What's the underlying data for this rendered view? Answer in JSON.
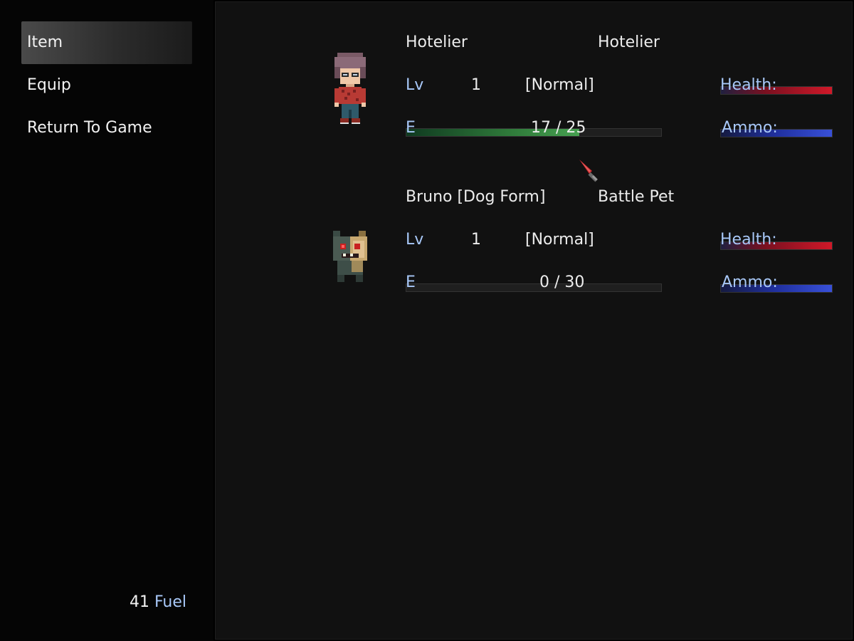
{
  "menu": {
    "items": [
      "Item",
      "Equip",
      "Return To Game"
    ],
    "selected_index": 0
  },
  "currency": {
    "amount": "41",
    "unit": "Fuel"
  },
  "labels": {
    "level": "Lv",
    "exp": "E",
    "hp": "Health:",
    "mp": "Ammo:"
  },
  "actors": [
    {
      "name": "Hotelier",
      "class": "Hotelier",
      "level": "1",
      "state": "[Normal]",
      "exp_text": "17 / 25",
      "exp_ratio": 0.68,
      "hp_ratio": 1.0,
      "mp_ratio": 1.0,
      "sprite": "hotelier-character-icon"
    },
    {
      "name": "Bruno [Dog Form]",
      "class": "Battle Pet",
      "level": "1",
      "state": "[Normal]",
      "exp_text": "0 / 30",
      "exp_ratio": 0.0,
      "hp_ratio": 1.0,
      "mp_ratio": 1.0,
      "sprite": "zombie-dog-character-icon"
    }
  ],
  "colors": {
    "system_text": "#a8c8f8",
    "hp_gauge": "#d01828",
    "mp_gauge": "#3850d8",
    "exp_gauge": "#46a050"
  }
}
